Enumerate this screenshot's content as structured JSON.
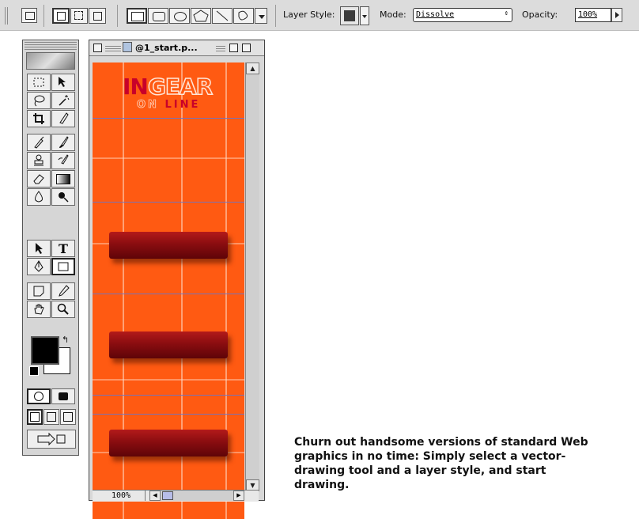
{
  "options_bar": {
    "layer_style_label": "Layer Style:",
    "mode_label": "Mode:",
    "mode_value": "Dissolve",
    "opacity_label": "Opacity:",
    "opacity_value": "100%",
    "layer_style_swatch_color": "#3c3c3c"
  },
  "document": {
    "title": "@1_start.p...",
    "zoom": "100%",
    "logo_in": "IN",
    "logo_gear": "GEAR",
    "logo_on": "ON",
    "logo_line": "LINE",
    "canvas_color": "#ff5a12",
    "button_color": "#8a0d10"
  },
  "toolbox": {
    "tools": [
      "rectangular-marquee",
      "move",
      "lasso",
      "magic-wand",
      "crop",
      "slice",
      "airbrush",
      "paintbrush",
      "rubber-stamp",
      "history-brush",
      "eraser",
      "gradient",
      "blur",
      "dodge",
      "path-selection",
      "type",
      "pen",
      "rectangle-shape",
      "notes",
      "eyedropper",
      "hand",
      "zoom"
    ],
    "foreground_color": "#000000",
    "background_color": "#ffffff"
  },
  "caption": "Churn out handsome versions of standard Web graphics in no time: Simply select a vector-drawing tool and a layer style, and start drawing."
}
